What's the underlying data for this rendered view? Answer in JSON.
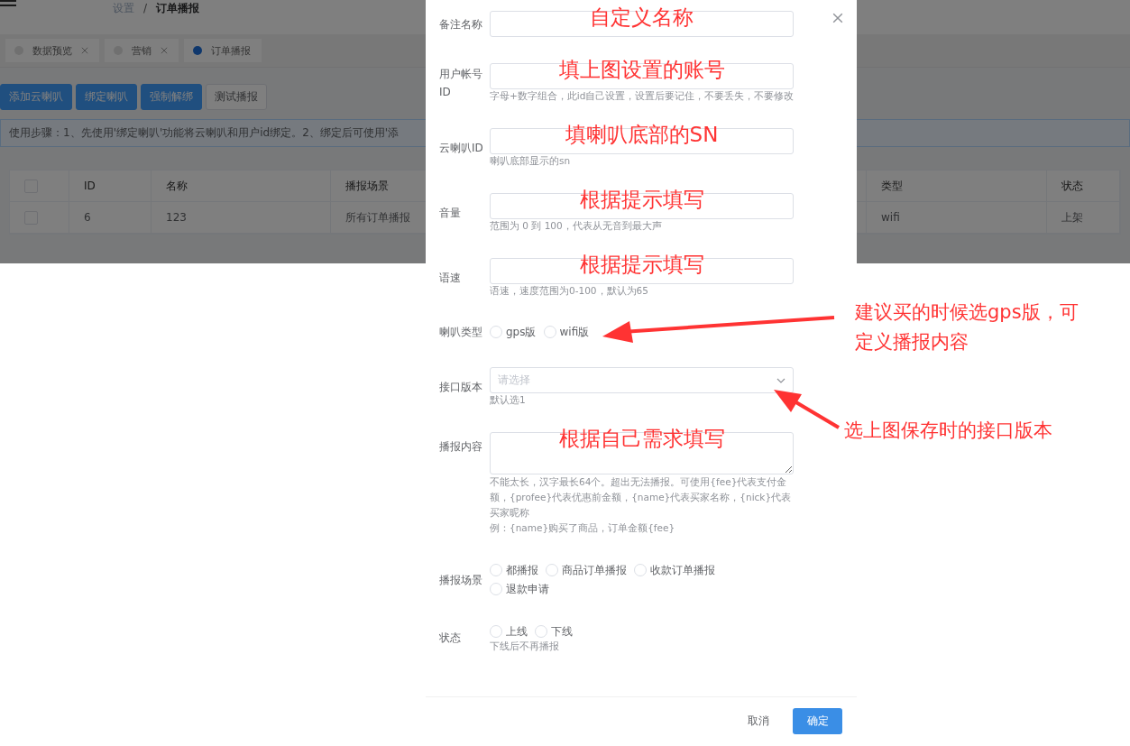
{
  "header": {
    "breadcrumb": [
      "设置",
      "订单播报"
    ],
    "separator": "/"
  },
  "tabs": [
    {
      "label": "数据预览",
      "selected": false,
      "closable": true
    },
    {
      "label": "营销",
      "selected": false,
      "closable": true
    },
    {
      "label": "订单播报",
      "selected": true,
      "closable": false
    }
  ],
  "toolbar": [
    {
      "label": "添加云喇叭",
      "kind": "primary"
    },
    {
      "label": "绑定喇叭",
      "kind": "primary"
    },
    {
      "label": "强制解绑",
      "kind": "primary"
    },
    {
      "label": "测试播报",
      "kind": "plain"
    }
  ],
  "notice": "使用步骤：1、先使用'绑定喇叭'功能将云喇叭和用户id绑定。2、绑定后可使用'添",
  "table": {
    "columns": [
      "ID",
      "名称",
      "播报场景",
      "类型",
      "状态"
    ],
    "rows": [
      {
        "checked": false,
        "cells": [
          "6",
          "123",
          "所有订单播报",
          "wifi",
          "上架"
        ]
      }
    ],
    "header_checked": false
  },
  "dialog": {
    "items": [
      {
        "kind": "input",
        "label": "备注名称",
        "annotation": "自定义名称"
      },
      {
        "kind": "input",
        "label": "用户帐号ID",
        "hint": "字母+数字组合，此id自己设置，设置后要记住，不要丢失，不要修改",
        "annotation": "填上图设置的账号"
      },
      {
        "kind": "input",
        "label": "云喇叭ID",
        "hint": "喇叭底部显示的sn",
        "annotation": "填喇叭底部的SN"
      },
      {
        "kind": "input",
        "label": "音量",
        "hint": "范围为 0 到 100，代表从无音到最大声",
        "annotation": "根据提示填写"
      },
      {
        "kind": "input",
        "label": "语速",
        "hint": "语速，速度范围为0-100，默认为65",
        "annotation": "根据提示填写"
      },
      {
        "kind": "radio",
        "label": "喇叭类型",
        "options": [
          {
            "label": "gps版",
            "selected": false
          },
          {
            "label": "wifi版",
            "selected": false
          }
        ]
      },
      {
        "kind": "select",
        "label": "接口版本",
        "placeholder": "请选择",
        "hint": "默认选1"
      },
      {
        "kind": "textarea",
        "label": "播报内容",
        "hint_lines": [
          "不能太长，汉字最长64个。超出无法播报。可使用{fee}代表支付金额，{profee}代表优惠前金额，{name}代表买家名称，{nick}代表买家昵称",
          "例：{name}购买了商品，订单金额{fee}"
        ],
        "annotation": "根据自己需求填写"
      },
      {
        "kind": "radio",
        "label": "播报场景",
        "options": [
          {
            "label": "都播报",
            "selected": false
          },
          {
            "label": "商品订单播报",
            "selected": false
          },
          {
            "label": "收款订单播报",
            "selected": false
          },
          {
            "label": "退款申请",
            "selected": false
          }
        ]
      },
      {
        "kind": "radio",
        "label": "状态",
        "options": [
          {
            "label": "上线",
            "selected": false
          },
          {
            "label": "下线",
            "selected": false
          }
        ],
        "hint": "下线后不再播报"
      }
    ],
    "cancel": "取消",
    "confirm": "确定"
  },
  "callouts": [
    {
      "lines": [
        "建议买的时候选gps版，可",
        "定义播报内容"
      ]
    },
    {
      "lines": [
        "选上图保存时的接口版本"
      ]
    }
  ]
}
